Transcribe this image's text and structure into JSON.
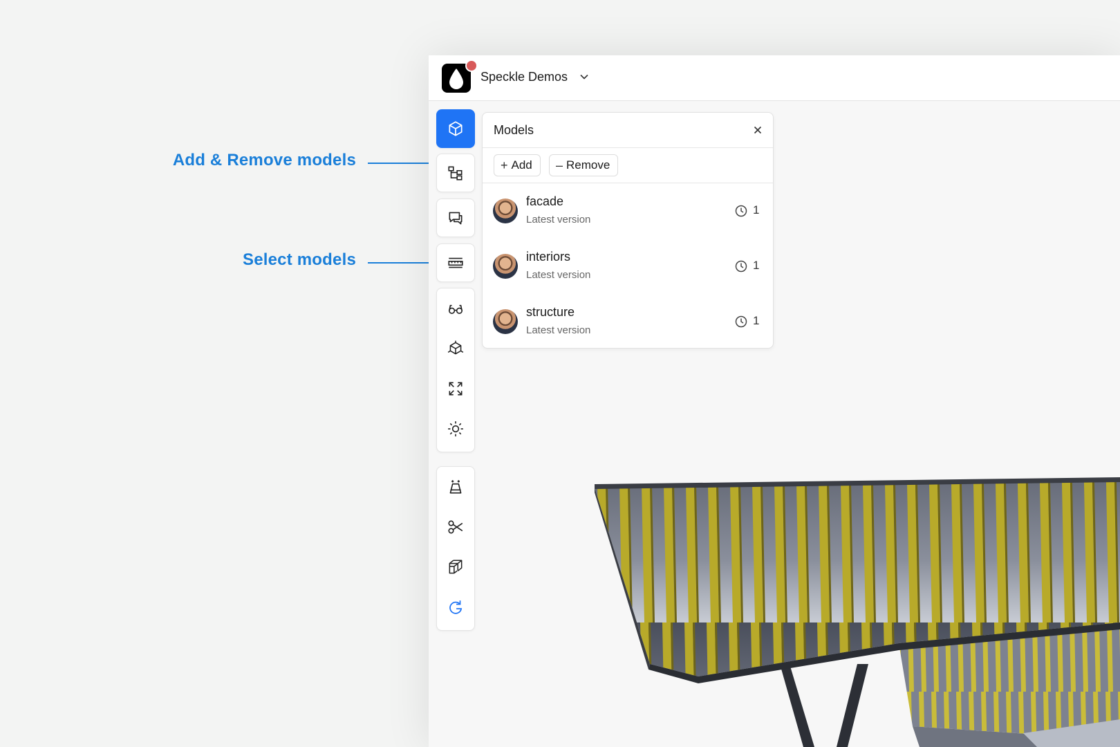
{
  "annotations": {
    "add_remove": "Add & Remove models",
    "select": "Select models"
  },
  "colors": {
    "annotation": "#1a7fd9",
    "accent": "#1f74f5",
    "notification": "#d85a5a"
  },
  "header": {
    "workspace_name": "Speckle Demos",
    "logo_icon": "speckle-drop-icon",
    "dropdown_icon": "chevron-down-icon"
  },
  "toolbar": {
    "group1": [
      {
        "name": "models-tool",
        "icon": "cube-icon",
        "active": true
      },
      {
        "name": "scene-explorer-tool",
        "icon": "tree-icon"
      },
      {
        "name": "discussions-tool",
        "icon": "chat-icon"
      },
      {
        "name": "measure-tool",
        "icon": "ruler-icon"
      }
    ],
    "group2": [
      {
        "name": "views-tool",
        "icon": "glasses-icon"
      },
      {
        "name": "projection-tool",
        "icon": "axes-cube-icon"
      },
      {
        "name": "zoom-extents-tool",
        "icon": "expand-icon"
      },
      {
        "name": "lighting-tool",
        "icon": "sun-icon"
      }
    ],
    "group3": [
      {
        "name": "explode-tool",
        "icon": "explode-icon"
      },
      {
        "name": "section-tool",
        "icon": "scissors-icon"
      },
      {
        "name": "filter-tool",
        "icon": "layers-cube-icon"
      },
      {
        "name": "reset-tool",
        "icon": "refresh-icon"
      }
    ]
  },
  "models_panel": {
    "title": "Models",
    "add_label": "Add",
    "remove_label": "Remove",
    "models": [
      {
        "name": "facade",
        "subtitle": "Latest version",
        "versions": "1"
      },
      {
        "name": "interiors",
        "subtitle": "Latest version",
        "versions": "1"
      },
      {
        "name": "structure",
        "subtitle": "Latest version",
        "versions": "1"
      }
    ]
  }
}
